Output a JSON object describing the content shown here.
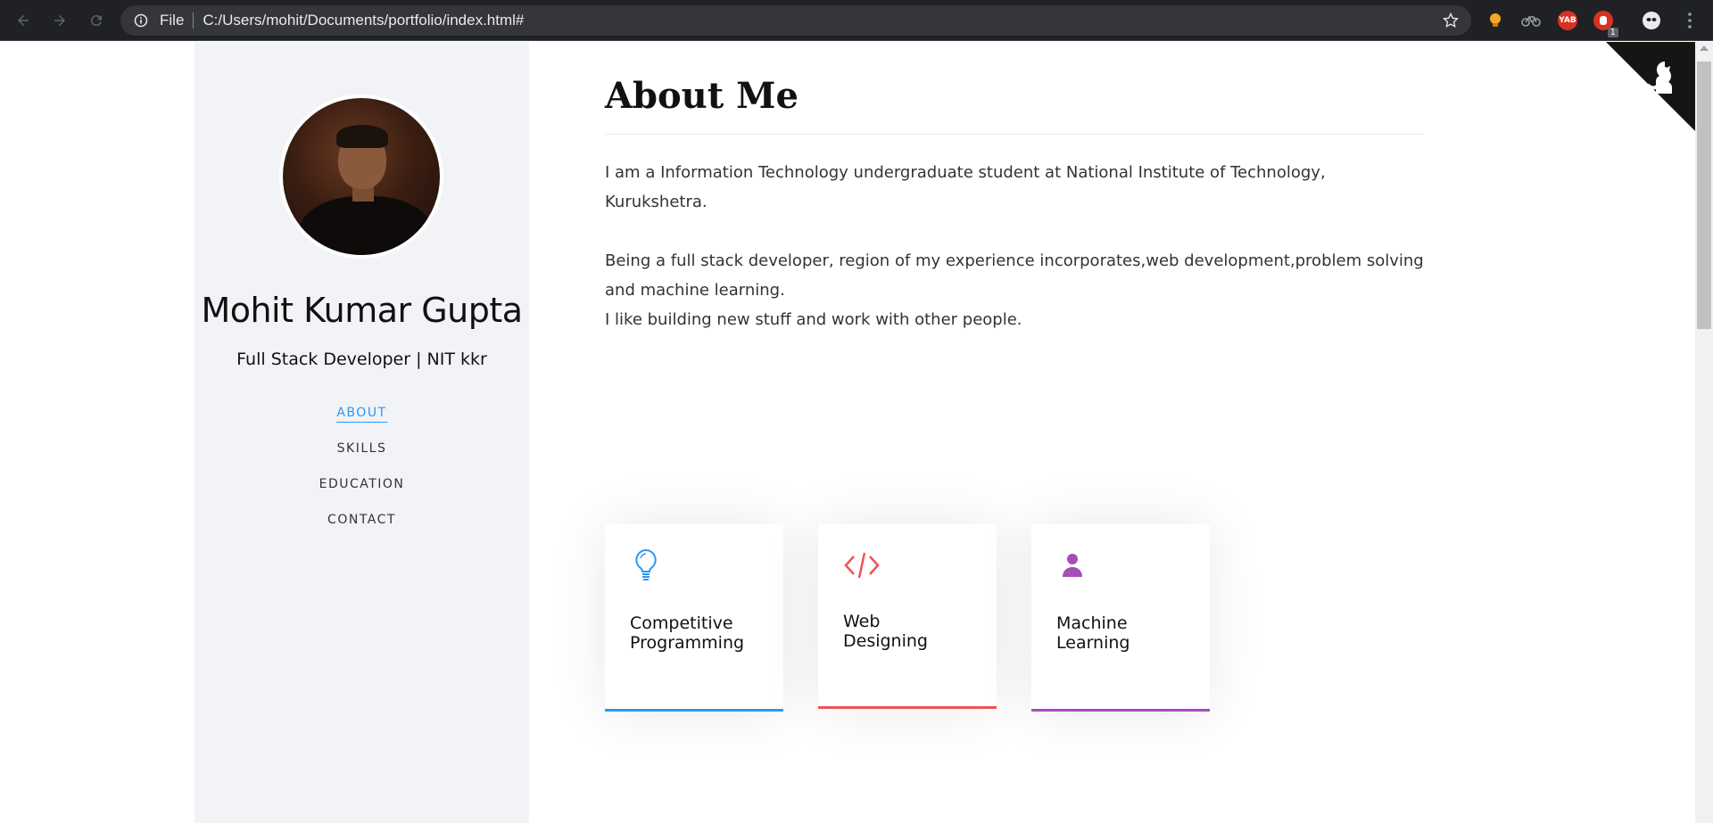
{
  "browser": {
    "scheme_label": "File",
    "url": "C:/Users/mohit/Documents/portfolio/index.html#",
    "extension_badge": "1",
    "extension_yab": "YAB"
  },
  "profile": {
    "name": "Mohit Kumar Gupta",
    "subtitle": "Full Stack Developer | NIT kkr"
  },
  "nav": {
    "items": [
      {
        "label": "ABOUT"
      },
      {
        "label": "SKILLS"
      },
      {
        "label": "EDUCATION"
      },
      {
        "label": "CONTACT"
      }
    ],
    "active_color": "#2c98f0"
  },
  "about": {
    "heading": "About Me",
    "paragraph1": "I am a Information Technology undergraduate student at National Institute of Technology, Kurukshetra.",
    "paragraph2_line1": "Being a full stack developer, region of my experience incorporates,web development,problem solving and machine learning.",
    "paragraph2_line2": "I like building new stuff and work with other people."
  },
  "cards": [
    {
      "line1": "Competitive",
      "line2": "Programming",
      "icon": "lightbulb-icon",
      "color": "#2c98f0"
    },
    {
      "line1": "Web",
      "line2": "Designing",
      "icon": "code-icon",
      "color": "#ec5453"
    },
    {
      "line1": "Machine",
      "line2": "Learning",
      "icon": "user-icon",
      "color": "#a84cb8"
    }
  ]
}
